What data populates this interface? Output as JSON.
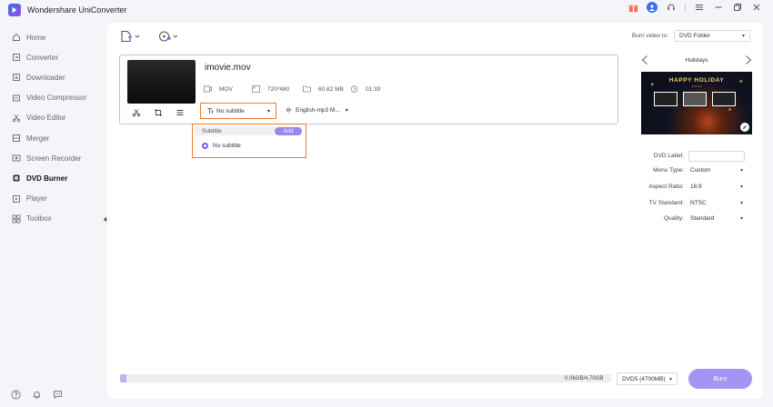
{
  "app": {
    "title": "Wondershare UniConverter"
  },
  "window_icons": [
    "gift-icon",
    "user-icon",
    "support-icon",
    "menu-icon",
    "minimize-icon",
    "maximize-icon",
    "close-icon"
  ],
  "sidebar": {
    "items": [
      {
        "label": "Home",
        "icon": "home-icon"
      },
      {
        "label": "Converter",
        "icon": "converter-icon"
      },
      {
        "label": "Downloader",
        "icon": "downloader-icon"
      },
      {
        "label": "Video Compressor",
        "icon": "compressor-icon"
      },
      {
        "label": "Video Editor",
        "icon": "scissors-icon"
      },
      {
        "label": "Merger",
        "icon": "merger-icon"
      },
      {
        "label": "Screen Recorder",
        "icon": "recorder-icon"
      },
      {
        "label": "DVD Burner",
        "icon": "dvd-icon",
        "active": true
      },
      {
        "label": "Player",
        "icon": "player-icon"
      },
      {
        "label": "Toolbox",
        "icon": "toolbox-icon"
      }
    ],
    "bottom_icons": [
      "help-icon",
      "bell-icon",
      "feedback-icon"
    ]
  },
  "toolbar": {
    "burn_to_label": "Burn video to:",
    "burn_to_value": "DVD Folder"
  },
  "file": {
    "name": "imovie.mov",
    "format": "MOV",
    "resolution": "720*480",
    "size": "60.82 MB",
    "duration": "01:39",
    "subtitle_value": "No subtitle",
    "audio_value": "English-mp3 M..."
  },
  "subtitle_dropdown": {
    "header": "Subtitle",
    "add_label": "Add",
    "option": "No subtitle"
  },
  "template": {
    "name": "Holidays",
    "preview_title": "HAPPY HOLIDAY",
    "preview_subtitle": "• • • • •"
  },
  "settings": {
    "dvd_label": {
      "label": "DVD Label:",
      "value": ""
    },
    "menu_type": {
      "label": "Menu Type:",
      "value": "Custom"
    },
    "aspect_ratio": {
      "label": "Aspect Ratio:",
      "value": "16:9"
    },
    "tv_standard": {
      "label": "TV Standard:",
      "value": "NTSC"
    },
    "quality": {
      "label": "Quality:",
      "value": "Standard"
    }
  },
  "bottom": {
    "size_text": "0.06GB/4.70GB",
    "progress": 0.013,
    "disc_value": "DVD5 (4700MB)",
    "burn_label": "Burn"
  },
  "colors": {
    "accent": "#9b86ee",
    "highlight_border": "#f07a26",
    "card_border": "#c5c0e9"
  }
}
